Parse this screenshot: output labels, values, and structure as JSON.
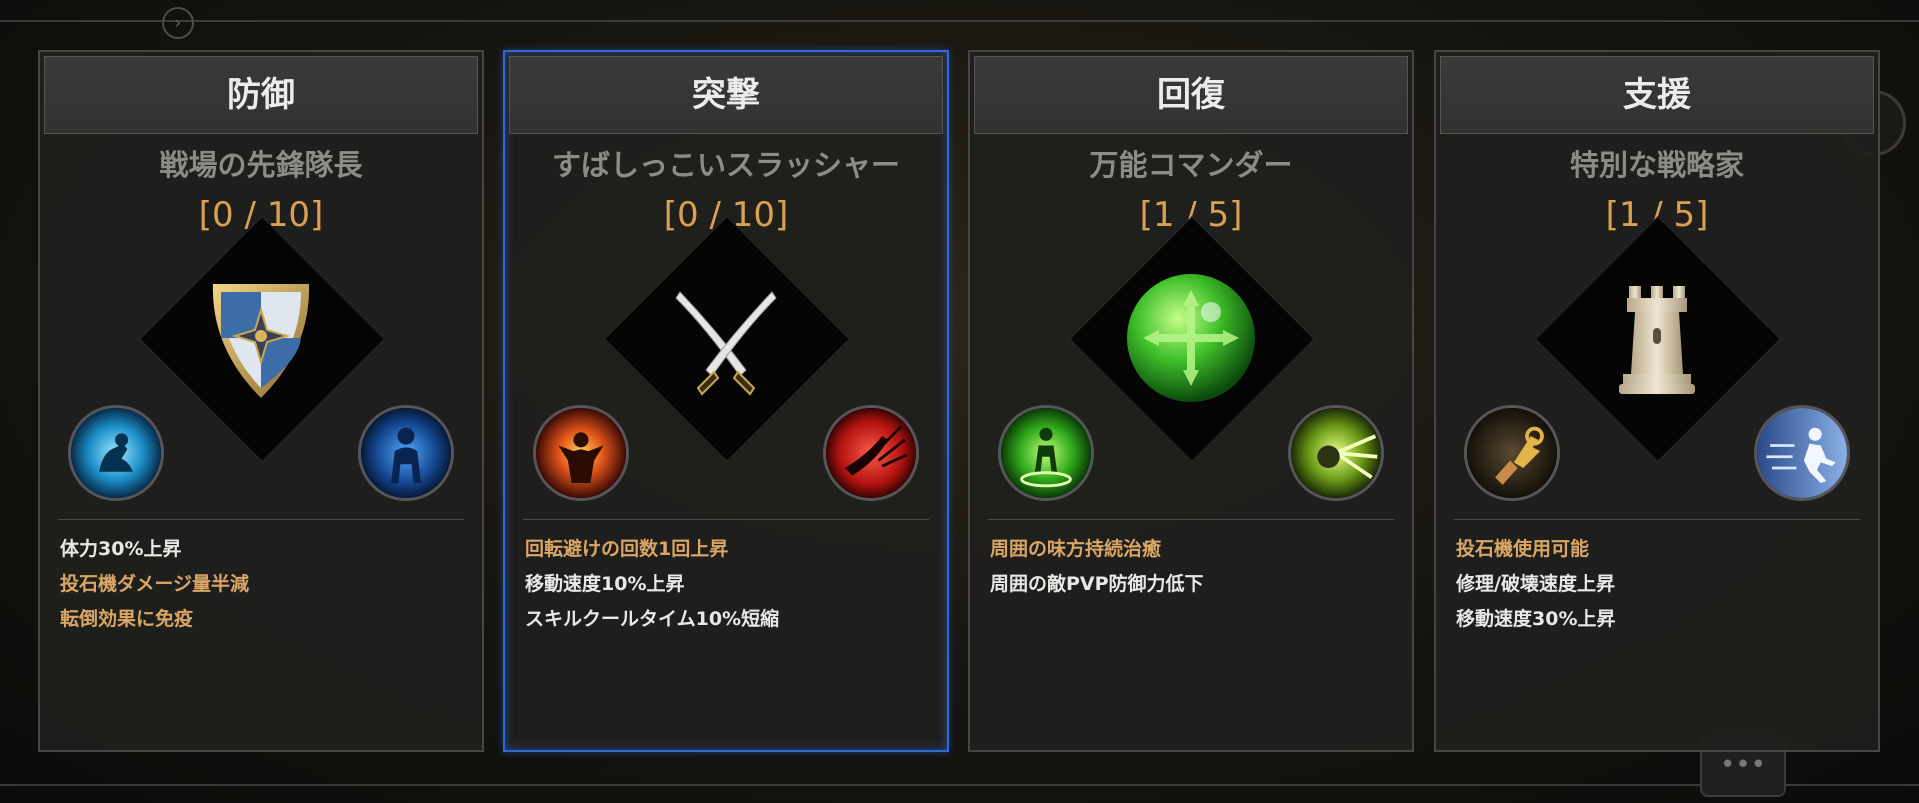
{
  "background": {
    "nav_icon": "circled-arrow-icon",
    "chat_icon": "chat-bubble-icon"
  },
  "cards": [
    {
      "id": "defense",
      "title": "防御",
      "subtitle": "戦場の先鋒隊長",
      "count": "[0 / 10]",
      "selected": false,
      "main_icon": "shield-icon",
      "skill_icons": [
        "blue-crouch-skill-icon",
        "blue-aura-figure-skill-icon"
      ],
      "effects": [
        {
          "text": "体力30%上昇",
          "highlight": false
        },
        {
          "text": "投石機ダメージ量半減",
          "highlight": true
        },
        {
          "text": "転倒効果に免疫",
          "highlight": true
        }
      ]
    },
    {
      "id": "assault",
      "title": "突撃",
      "subtitle": "すばしっこいスラッシャー",
      "count": "[0 / 10]",
      "selected": true,
      "main_icon": "crossed-blades-icon",
      "skill_icons": [
        "fire-warrior-skill-icon",
        "red-slash-skill-icon"
      ],
      "effects": [
        {
          "text": "回転避けの回数1回上昇",
          "highlight": true
        },
        {
          "text": "移動速度10%上昇",
          "highlight": false
        },
        {
          "text": "スキルクールタイム10%短縮",
          "highlight": false
        }
      ]
    },
    {
      "id": "recovery",
      "title": "回復",
      "subtitle": "万能コマンダー",
      "count": "[1 / 5]",
      "selected": false,
      "main_icon": "green-orb-cross-icon",
      "skill_icons": [
        "green-heal-figure-skill-icon",
        "green-burst-skill-icon"
      ],
      "effects": [
        {
          "text": "周囲の味方持続治癒",
          "highlight": true
        },
        {
          "text": "周囲の敵PVP防御力低下",
          "highlight": false
        }
      ]
    },
    {
      "id": "support",
      "title": "支援",
      "subtitle": "特別な戦略家",
      "count": "[1 / 5]",
      "selected": false,
      "main_icon": "rook-tower-icon",
      "skill_icons": [
        "wrench-hand-skill-icon",
        "sprint-runner-skill-icon"
      ],
      "effects": [
        {
          "text": "投石機使用可能",
          "highlight": true
        },
        {
          "text": "修理/破壊速度上昇",
          "highlight": false
        },
        {
          "text": "移動速度30%上昇",
          "highlight": false
        }
      ]
    }
  ]
}
